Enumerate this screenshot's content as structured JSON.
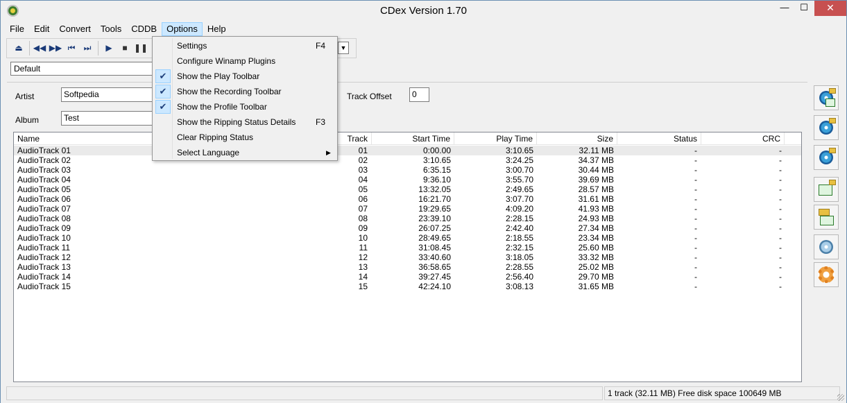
{
  "window": {
    "title": "CDex Version 1.70"
  },
  "titlebar": {
    "minimize": "—",
    "maximize": "☐",
    "close": "✕"
  },
  "menubar": [
    "File",
    "Edit",
    "Convert",
    "Tools",
    "CDDB",
    "Options",
    "Help"
  ],
  "profile": {
    "value": "Default"
  },
  "info": {
    "artist_label": "Artist",
    "artist_value": "Softpedia",
    "album_label": "Album",
    "album_value": "Test",
    "track_offset_label": "Track Offset",
    "track_offset_value": "0"
  },
  "columns": [
    "Name",
    "Track",
    "Start Time",
    "Play Time",
    "Size",
    "Status",
    "CRC"
  ],
  "tracks": [
    {
      "name": "AudioTrack 01",
      "track": "01",
      "start": "0:00.00",
      "play": "3:10.65",
      "size": "32.11 MB",
      "status": "-",
      "crc": "-"
    },
    {
      "name": "AudioTrack 02",
      "track": "02",
      "start": "3:10.65",
      "play": "3:24.25",
      "size": "34.37 MB",
      "status": "-",
      "crc": "-"
    },
    {
      "name": "AudioTrack 03",
      "track": "03",
      "start": "6:35.15",
      "play": "3:00.70",
      "size": "30.44 MB",
      "status": "-",
      "crc": "-"
    },
    {
      "name": "AudioTrack 04",
      "track": "04",
      "start": "9:36.10",
      "play": "3:55.70",
      "size": "39.69 MB",
      "status": "-",
      "crc": "-"
    },
    {
      "name": "AudioTrack 05",
      "track": "05",
      "start": "13:32.05",
      "play": "2:49.65",
      "size": "28.57 MB",
      "status": "-",
      "crc": "-"
    },
    {
      "name": "AudioTrack 06",
      "track": "06",
      "start": "16:21.70",
      "play": "3:07.70",
      "size": "31.61 MB",
      "status": "-",
      "crc": "-"
    },
    {
      "name": "AudioTrack 07",
      "track": "07",
      "start": "19:29.65",
      "play": "4:09.20",
      "size": "41.93 MB",
      "status": "-",
      "crc": "-"
    },
    {
      "name": "AudioTrack 08",
      "track": "08",
      "start": "23:39.10",
      "play": "2:28.15",
      "size": "24.93 MB",
      "status": "-",
      "crc": "-"
    },
    {
      "name": "AudioTrack 09",
      "track": "09",
      "start": "26:07.25",
      "play": "2:42.40",
      "size": "27.34 MB",
      "status": "-",
      "crc": "-"
    },
    {
      "name": "AudioTrack 10",
      "track": "10",
      "start": "28:49.65",
      "play": "2:18.55",
      "size": "23.34 MB",
      "status": "-",
      "crc": "-"
    },
    {
      "name": "AudioTrack 11",
      "track": "11",
      "start": "31:08.45",
      "play": "2:32.15",
      "size": "25.60 MB",
      "status": "-",
      "crc": "-"
    },
    {
      "name": "AudioTrack 12",
      "track": "12",
      "start": "33:40.60",
      "play": "3:18.05",
      "size": "33.32 MB",
      "status": "-",
      "crc": "-"
    },
    {
      "name": "AudioTrack 13",
      "track": "13",
      "start": "36:58.65",
      "play": "2:28.55",
      "size": "25.02 MB",
      "status": "-",
      "crc": "-"
    },
    {
      "name": "AudioTrack 14",
      "track": "14",
      "start": "39:27.45",
      "play": "2:56.40",
      "size": "29.70 MB",
      "status": "-",
      "crc": "-"
    },
    {
      "name": "AudioTrack 15",
      "track": "15",
      "start": "42:24.10",
      "play": "3:08.13",
      "size": "31.65 MB",
      "status": "-",
      "crc": "-"
    }
  ],
  "options_menu": [
    {
      "label": "Settings",
      "shortcut": "F4",
      "checked": false,
      "submenu": false
    },
    {
      "label": "Configure Winamp Plugins",
      "shortcut": "",
      "checked": false,
      "submenu": false
    },
    {
      "label": "Show the Play Toolbar",
      "shortcut": "",
      "checked": true,
      "submenu": false
    },
    {
      "label": "Show the Recording Toolbar",
      "shortcut": "",
      "checked": true,
      "submenu": false
    },
    {
      "label": "Show the Profile Toolbar",
      "shortcut": "",
      "checked": true,
      "submenu": false
    },
    {
      "label": "Show the Ripping Status Details",
      "shortcut": "F3",
      "checked": false,
      "submenu": false
    },
    {
      "label": "Clear Ripping Status",
      "shortcut": "",
      "checked": false,
      "submenu": false
    },
    {
      "label": "Select Language",
      "shortcut": "",
      "checked": false,
      "submenu": true
    }
  ],
  "status": {
    "text": "1 track (32.11 MB) Free disk space 100649 MB"
  },
  "colors": {
    "selection": "#cce8ff",
    "close_button": "#c75050",
    "icon_blue": "#1a3a78"
  },
  "side_buttons": [
    "extract-tracks-icon",
    "extract-partial-icon",
    "extract-mp3-icon",
    "convert-wav-icon",
    "record-icon",
    "cddb-query-icon",
    "settings-gear-icon"
  ]
}
